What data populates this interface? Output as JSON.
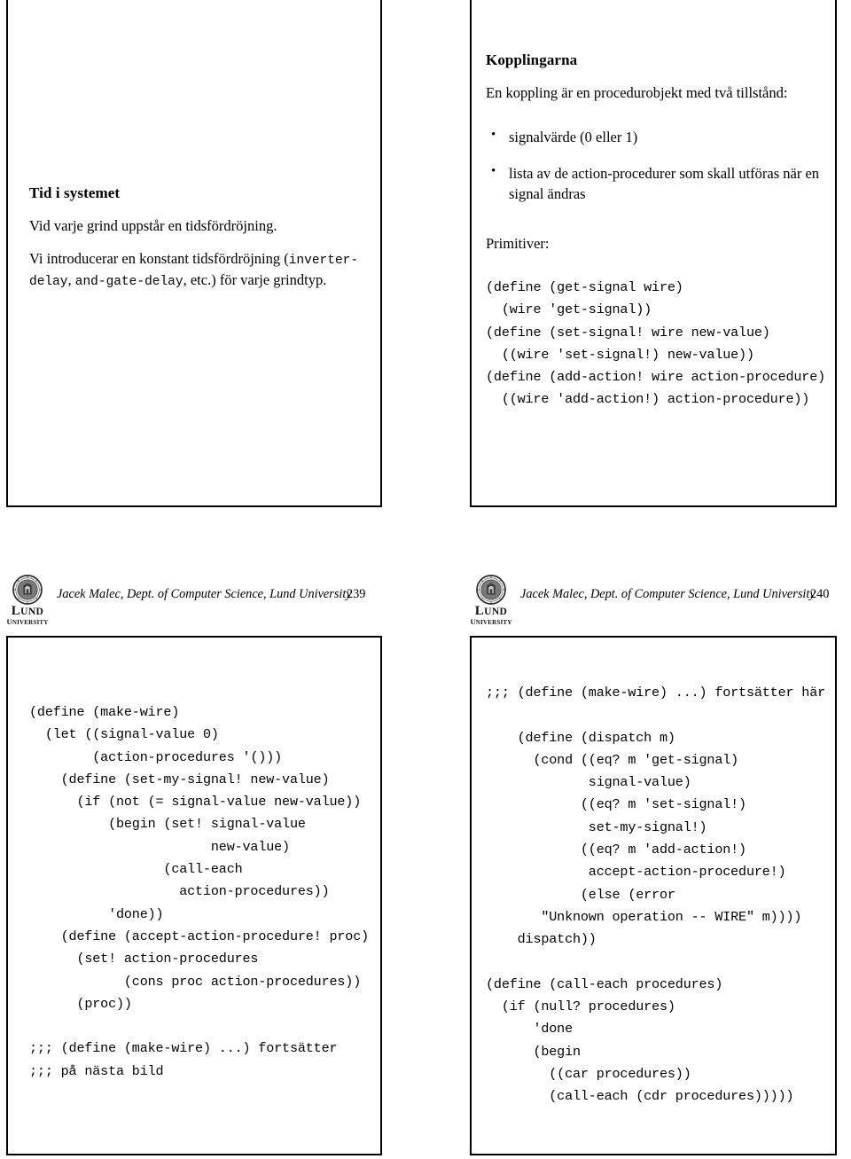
{
  "page": {
    "kind": "lecture-slide-handout",
    "background": "#ffffff",
    "ink": "#000000"
  },
  "slides": [
    {
      "id": "slide-top-left",
      "position": "top-left",
      "title": "Tid i systemet",
      "paragraphs": [
        [
          {
            "t": "text",
            "v": "Vid varje grind uppstår en tidsfördröjning."
          }
        ],
        [
          {
            "t": "text",
            "v": "Vi introducerar en konstant tidsfördröjning ("
          },
          {
            "t": "mono",
            "v": "inverter-delay"
          },
          {
            "t": "text",
            "v": ", "
          },
          {
            "t": "mono",
            "v": "and-gate-delay"
          },
          {
            "t": "text",
            "v": ", etc.) för varje grindtyp."
          }
        ]
      ]
    },
    {
      "id": "slide-top-right",
      "position": "top-right",
      "title": "Kopplingarna",
      "intro": "En koppling är en procedurobjekt med två tillstånd:",
      "bullets": [
        "signalvärde (0 eller 1)",
        "lista av de action-procedurer som skall utföras när en signal ändras"
      ],
      "subhead": "Primitiver:",
      "code": "(define (get-signal wire)\n  (wire 'get-signal))\n(define (set-signal! wire new-value)\n  ((wire 'set-signal!) new-value))\n(define (add-action! wire action-procedure)\n  ((wire 'add-action!) action-procedure))"
    },
    {
      "id": "slide-bottom-left",
      "position": "bottom-left",
      "code": "(define (make-wire)\n  (let ((signal-value 0)\n        (action-procedures '()))\n    (define (set-my-signal! new-value)\n      (if (not (= signal-value new-value))\n          (begin (set! signal-value\n                       new-value)\n                 (call-each\n                   action-procedures))\n          'done))\n    (define (accept-action-procedure! proc)\n      (set! action-procedures\n            (cons proc action-procedures))\n      (proc))\n\n;;; (define (make-wire) ...) fortsätter\n;;; på nästa bild"
    },
    {
      "id": "slide-bottom-right",
      "position": "bottom-right",
      "code": ";;; (define (make-wire) ...) fortsätter här\n\n    (define (dispatch m)\n      (cond ((eq? m 'get-signal)\n             signal-value)\n            ((eq? m 'set-signal!)\n             set-my-signal!)\n            ((eq? m 'add-action!)\n             accept-action-procedure!)\n            (else (error\n       \"Unknown operation -- WIRE\" m))))\n    dispatch))\n\n(define (call-each procedures)\n  (if (null? procedures)\n      'done\n      (begin\n        ((car procedures))\n        (call-each (cdr procedures)))))"
    }
  ],
  "footers": [
    {
      "id": "footer-left",
      "logo_primary": "LUND",
      "logo_secondary": "UNIVERSITY",
      "attribution": "Jacek Malec, Dept. of Computer Science, Lund University",
      "page_number": "239"
    },
    {
      "id": "footer-right",
      "logo_primary": "LUND",
      "logo_secondary": "UNIVERSITY",
      "attribution": "Jacek Malec, Dept. of Computer Science, Lund University",
      "page_number": "240"
    }
  ]
}
